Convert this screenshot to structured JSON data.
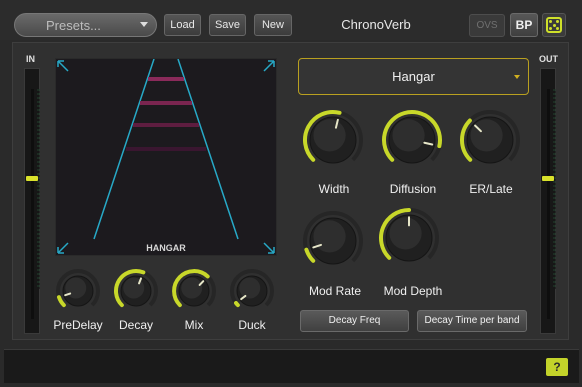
{
  "header": {
    "presets_label": "Presets...",
    "load_label": "Load",
    "save_label": "Save",
    "new_label": "New",
    "title": "ChronoVerb",
    "ovs_label": "OVS",
    "bp_label": "BP",
    "randomize_icon": "dice-icon"
  },
  "meters": {
    "in_label": "IN",
    "out_label": "OUT",
    "in_fader_level": 0.62,
    "out_fader_level": 0.62
  },
  "room_display": {
    "label": "HANGAR"
  },
  "room_select": {
    "value": "Hangar"
  },
  "knobs": {
    "width": {
      "label": "Width",
      "value": 0.55
    },
    "diffusion": {
      "label": "Diffusion",
      "value": 0.88
    },
    "er_late": {
      "label": "ER/Late",
      "value": 0.33
    },
    "mod_rate": {
      "label": "Mod Rate",
      "value": 0.1
    },
    "mod_depth": {
      "label": "Mod Depth",
      "value": 0.5
    },
    "predelay": {
      "label": "PreDelay",
      "value": 0.1
    },
    "decay": {
      "label": "Decay",
      "value": 0.58
    },
    "mix": {
      "label": "Mix",
      "value": 0.66
    },
    "duck": {
      "label": "Duck",
      "value": 0.03
    }
  },
  "buttons": {
    "decay_freq": "Decay Freq",
    "decay_time_per_band": "Decay Time per band"
  },
  "footer": {
    "help_label": "?"
  },
  "colors": {
    "accent": "#c8d82a",
    "display_lines": "#27a9c7",
    "display_bars": "#8a2a5a"
  }
}
